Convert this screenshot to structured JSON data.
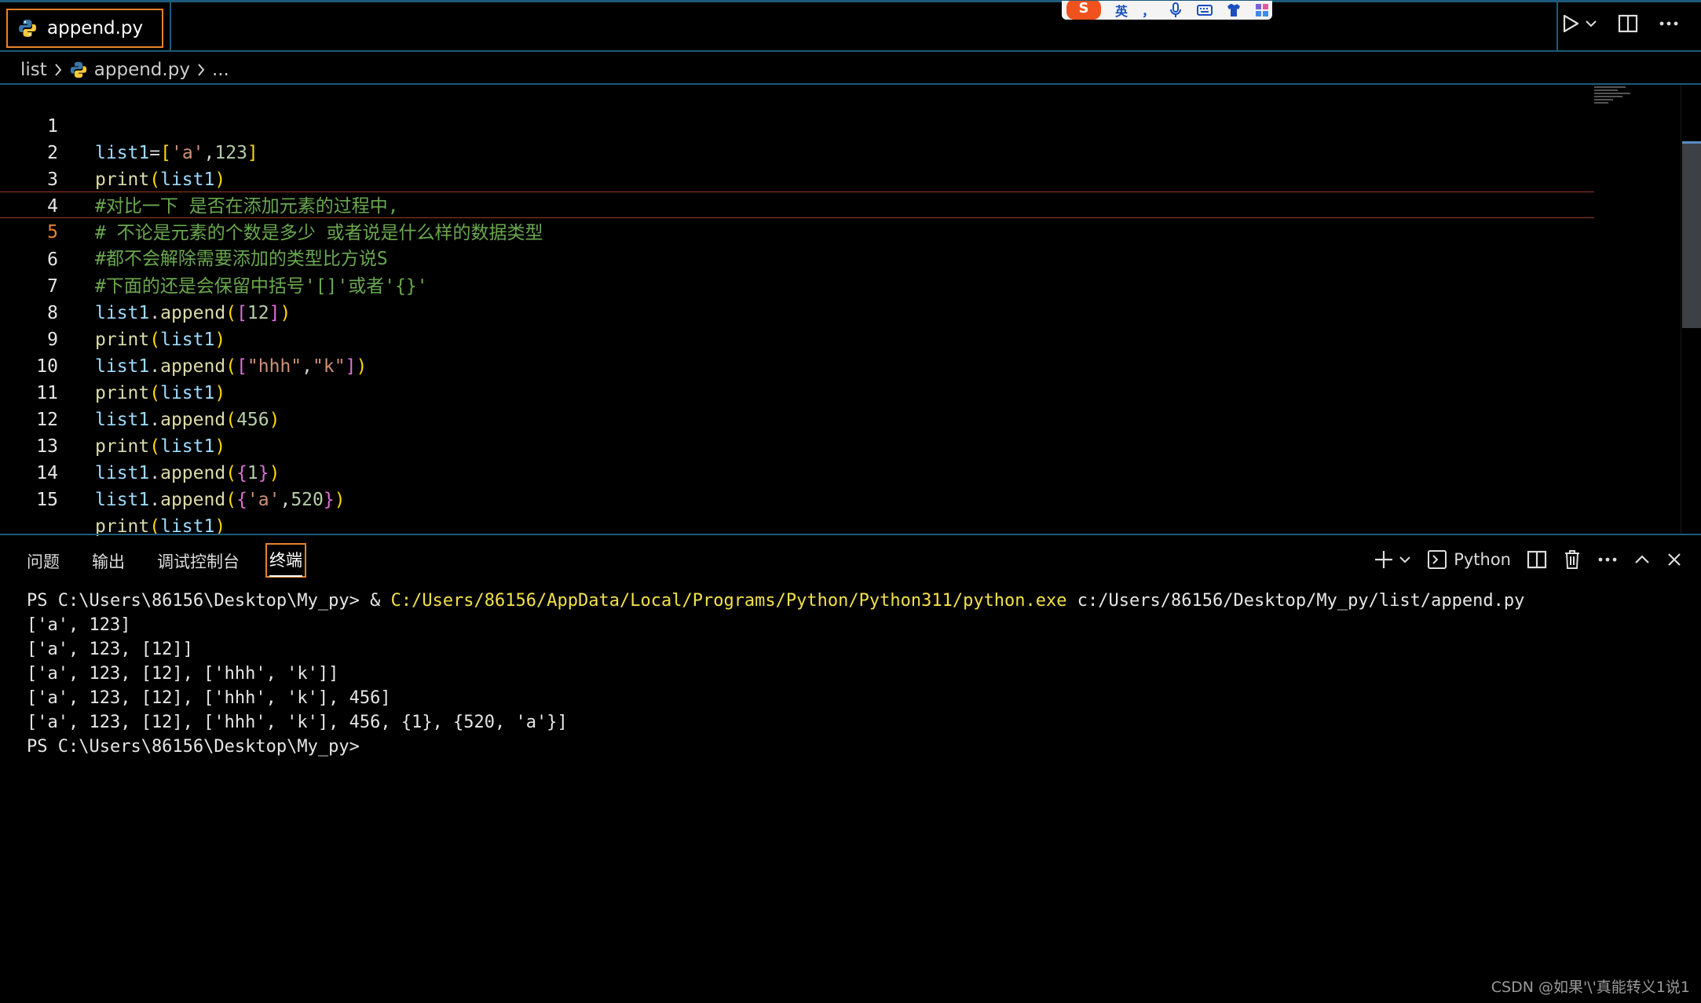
{
  "tab": {
    "filename": "append.py",
    "modified_indicator": "unsaved"
  },
  "ime_toolbar": {
    "logo": "S",
    "mode": "英",
    "punct": "，"
  },
  "breadcrumb": {
    "folder": "list",
    "file": "append.py",
    "more": "..."
  },
  "editor": {
    "active_line": 5,
    "lines": [
      {
        "num": "1"
      },
      {
        "num": "2"
      },
      {
        "num": "3"
      },
      {
        "num": "4"
      },
      {
        "num": "5"
      },
      {
        "num": "6"
      },
      {
        "num": "7"
      },
      {
        "num": "8"
      },
      {
        "num": "9"
      },
      {
        "num": "10"
      },
      {
        "num": "11"
      },
      {
        "num": "12"
      },
      {
        "num": "13"
      },
      {
        "num": "14"
      },
      {
        "num": "15"
      }
    ],
    "tokens": {
      "l1": [
        "list1",
        "=",
        "[",
        "'a'",
        ",",
        "123",
        "]"
      ],
      "l2": [
        "print",
        "(",
        "list1",
        ")"
      ],
      "l3": "#对比一下 是否在添加元素的过程中,",
      "l4": "# 不论是元素的个数是多少 或者说是什么样的数据类型",
      "l5": "#都不会解除需要添加的类型比方说S",
      "l6": "#下面的还是会保留中括号'[]'或者'{}'",
      "l7": [
        "list1",
        ".",
        "append",
        "(",
        "[",
        "12",
        "]",
        ")"
      ],
      "l8": [
        "print",
        "(",
        "list1",
        ")"
      ],
      "l9": [
        "list1",
        ".",
        "append",
        "(",
        "[",
        "\"hhh\"",
        ",",
        "\"k\"",
        "]",
        ")"
      ],
      "l10": [
        "print",
        "(",
        "list1",
        ")"
      ],
      "l11": [
        "list1",
        ".",
        "append",
        "(",
        "456",
        ")"
      ],
      "l12": [
        "print",
        "(",
        "list1",
        ")"
      ],
      "l13": [
        "list1",
        ".",
        "append",
        "(",
        "{",
        "1",
        "}",
        ")"
      ],
      "l14": [
        "list1",
        ".",
        "append",
        "(",
        "{",
        "'a'",
        ",",
        "520",
        "}",
        ")"
      ],
      "l15": [
        "print",
        "(",
        "list1",
        ")"
      ]
    }
  },
  "panel": {
    "tabs": [
      {
        "label": "问题"
      },
      {
        "label": "输出"
      },
      {
        "label": "调试控制台"
      },
      {
        "label": "终端",
        "active": true
      }
    ],
    "terminal_profile": "Python"
  },
  "terminal": {
    "prompt1": "PS C:\\Users\\86156\\Desktop\\My_py> ",
    "amp": "& ",
    "exe": "C:/Users/86156/AppData/Local/Programs/Python/Python311/python.exe",
    "script": " c:/Users/86156/Desktop/My_py/list/append.py",
    "out1": "['a', 123]",
    "out2": "['a', 123, [12]]",
    "out3": "['a', 123, [12], ['hhh', 'k']]",
    "out4": "['a', 123, [12], ['hhh', 'k'], 456]",
    "out5": "['a', 123, [12], ['hhh', 'k'], 456, {1}, {520, 'a'}]",
    "prompt2": "PS C:\\Users\\86156\\Desktop\\My_py>"
  },
  "watermark": "CSDN @如果'\\'真能转义1说1",
  "colors": {
    "accent_orange": "#e8822a",
    "border_blue": "#1e5a7a",
    "comment_green": "#6aa84f",
    "variable_blue": "#9cdcfe",
    "function_yellow": "#dcdcaa",
    "string_orange": "#ce9178",
    "number_green": "#b5cea8",
    "terminal_path_yellow": "#f2e14a"
  }
}
